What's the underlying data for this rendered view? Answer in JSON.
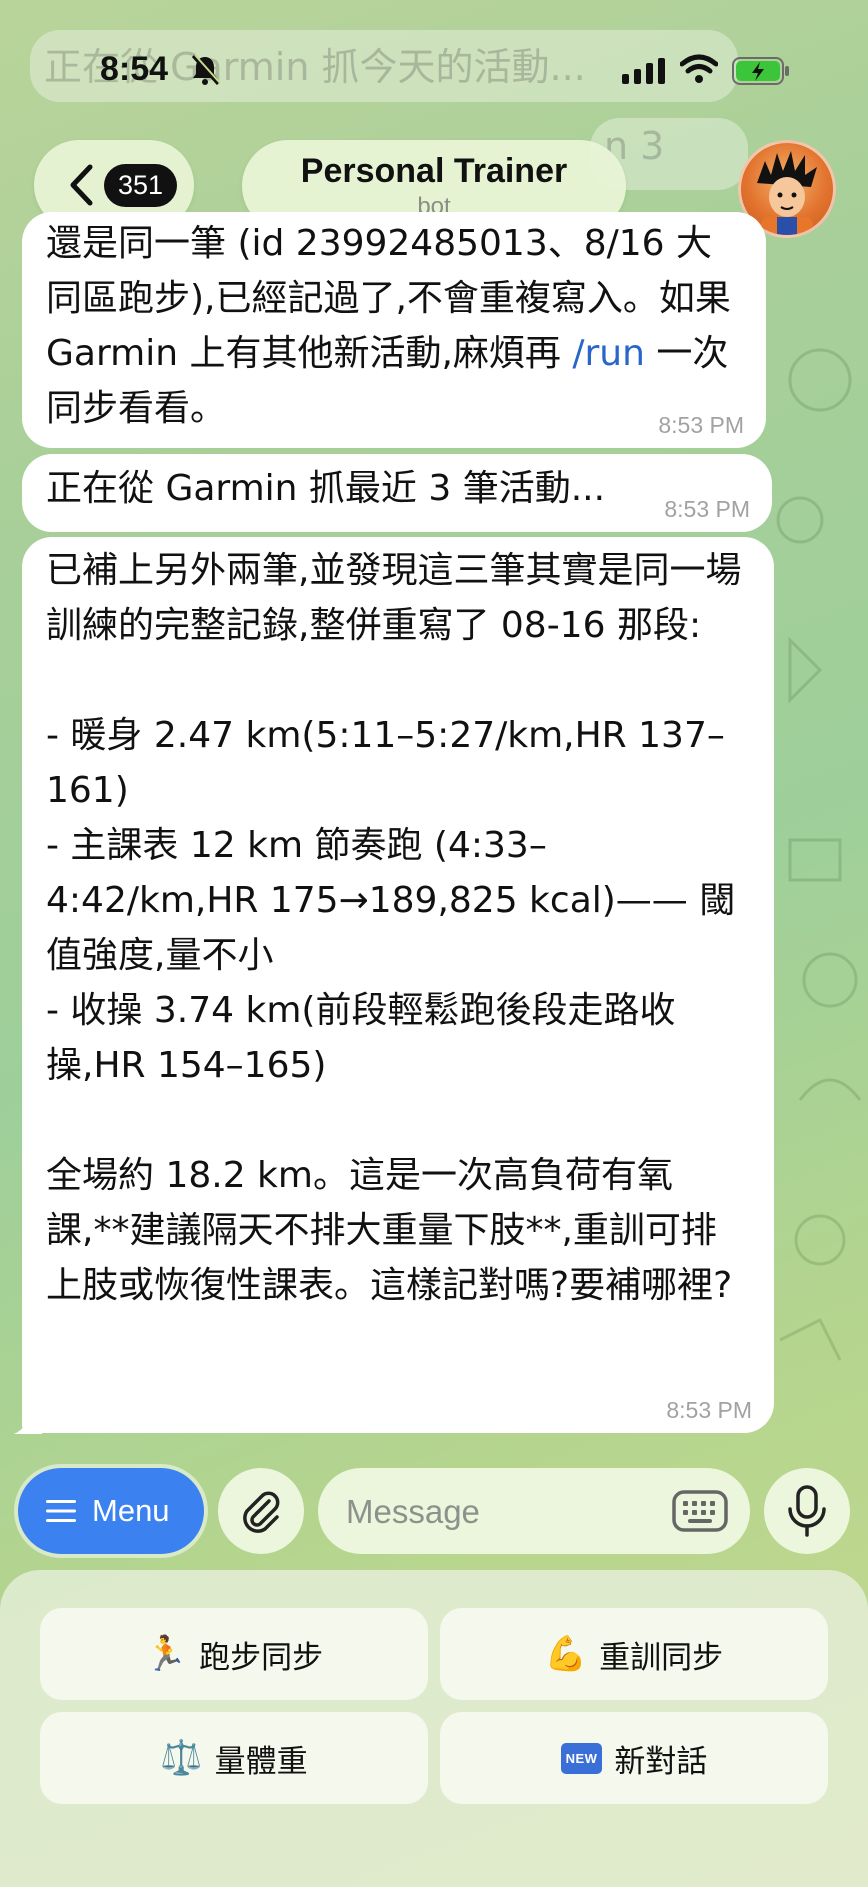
{
  "status_bar": {
    "time": "8:54"
  },
  "ghost": {
    "line1": "正在從 Garmin 抓今天的活動...",
    "line2": "n 3"
  },
  "header": {
    "back_count": "351",
    "title": "Personal Trainer",
    "subtitle": "bot",
    "avatar_icon": "bot-avatar-icon"
  },
  "messages": [
    {
      "text_before": "還是同一筆 (id 23992485013、8/16 大同區跑步),已經記過了,不會重複寫入。如果 Garmin 上有其他新活動,麻煩再 ",
      "link": "/run",
      "text_after": " 一次同步看看。",
      "time": "8:53 PM"
    },
    {
      "text": "正在從 Garmin 抓最近 3 筆活動...",
      "time": "8:53 PM"
    },
    {
      "text": "已補上另外兩筆,並發現這三筆其實是同一場訓練的完整記錄,整併重寫了 08-16 那段:\n\n- 暖身 2.47 km(5:11–5:27/km,HR 137–161)\n- 主課表 12 km 節奏跑 (4:33–4:42/km,HR 175→189,825 kcal)—— 閾值強度,量不小\n- 收操 3.74 km(前段輕鬆跑後段走路收操,HR 154–165)\n\n全場約 18.2 km。這是一次高負荷有氧課,**建議隔天不排大重量下肢**,重訓可排上肢或恢復性課表。這樣記對嗎?要補哪裡?",
      "time": "8:53 PM"
    }
  ],
  "composer": {
    "menu_label": "Menu",
    "message_placeholder": "Message"
  },
  "keyboard": [
    {
      "emoji": "🏃",
      "label": "跑步同步"
    },
    {
      "emoji": "💪",
      "label": "重訓同步"
    },
    {
      "emoji": "⚖️",
      "label": "量體重"
    },
    {
      "badge": "NEW",
      "label": "新對話"
    }
  ],
  "colors": {
    "accent": "#3b82f0",
    "link": "#2a66c9",
    "bubble": "#ffffff"
  }
}
